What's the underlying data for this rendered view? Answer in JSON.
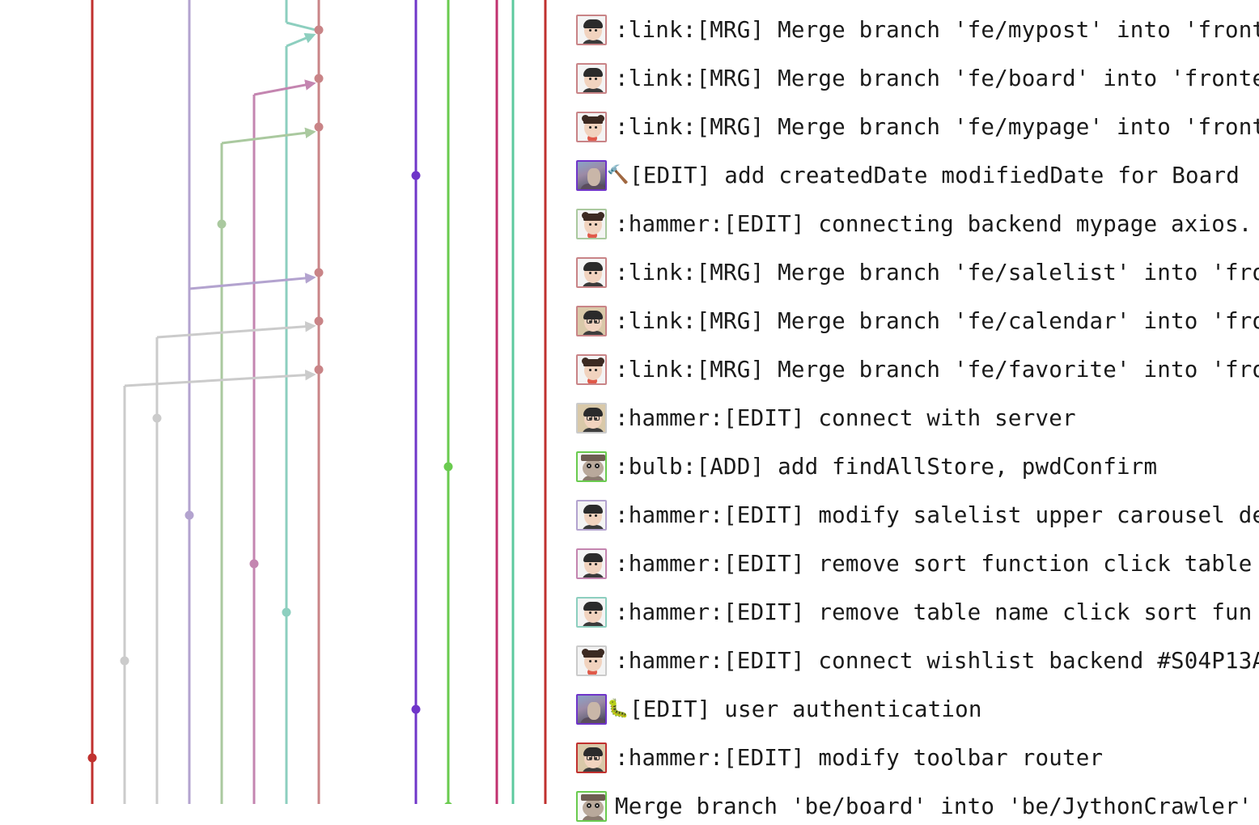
{
  "lanes": [
    {
      "id": "red-main",
      "color": "#c0312f"
    },
    {
      "id": "grey-a",
      "color": "#cbcbcb"
    },
    {
      "id": "grey-b",
      "color": "#cbcbcb"
    },
    {
      "id": "lavender",
      "color": "#b3a3cf"
    },
    {
      "id": "sage",
      "color": "#aac99f"
    },
    {
      "id": "pink",
      "color": "#c485b0"
    },
    {
      "id": "teal",
      "color": "#8dcfbf"
    },
    {
      "id": "rose",
      "color": "#c98487"
    },
    {
      "id": "purple",
      "color": "#6f35c9"
    },
    {
      "id": "green",
      "color": "#6acb4f"
    },
    {
      "id": "magenta",
      "color": "#c0316f"
    },
    {
      "id": "mint",
      "color": "#5cc99e"
    },
    {
      "id": "brick",
      "color": "#c0312f"
    }
  ],
  "commits": [
    {
      "avatar": "round-boy",
      "border": "#c98487",
      "icon": "",
      "message": ":link:[MRG] Merge branch 'fe/mypost' into 'front"
    },
    {
      "avatar": "round-boy",
      "border": "#c98487",
      "icon": "",
      "message": ":link:[MRG] Merge branch 'fe/board' into 'fronte"
    },
    {
      "avatar": "girl",
      "border": "#c98487",
      "icon": "",
      "message": ":link:[MRG] Merge branch 'fe/mypage' into 'front"
    },
    {
      "avatar": "photo",
      "border": "#6f35c9",
      "icon": "🔨",
      "message": "[EDIT] add createdDate modifiedDate for Board"
    },
    {
      "avatar": "girl",
      "border": "#aac99f",
      "icon": "",
      "message": ":hammer:[EDIT] connecting backend mypage axios."
    },
    {
      "avatar": "round-boy",
      "border": "#c98487",
      "icon": "",
      "message": ":link:[MRG] Merge branch 'fe/salelist' into 'fro"
    },
    {
      "avatar": "glasses",
      "border": "#c98487",
      "icon": "",
      "message": ":link:[MRG] Merge branch 'fe/calendar' into 'fro"
    },
    {
      "avatar": "girl",
      "border": "#c98487",
      "icon": "",
      "message": ":link:[MRG] Merge branch 'fe/favorite' into 'fro"
    },
    {
      "avatar": "glasses",
      "border": "#cbcbcb",
      "icon": "",
      "message": ":hammer:[EDIT] connect with server"
    },
    {
      "avatar": "owl",
      "border": "#6acb4f",
      "icon": "",
      "message": ":bulb:[ADD] add findAllStore, pwdConfirm"
    },
    {
      "avatar": "round-boy",
      "border": "#b3a3cf",
      "icon": "",
      "message": ":hammer:[EDIT] modify salelist upper carousel de"
    },
    {
      "avatar": "round-boy",
      "border": "#c485b0",
      "icon": "",
      "message": ":hammer:[EDIT] remove sort function click table"
    },
    {
      "avatar": "round-boy",
      "border": "#8dcfbf",
      "icon": "",
      "message": ":hammer:[EDIT] remove table name click sort fun"
    },
    {
      "avatar": "girl",
      "border": "#cbcbcb",
      "icon": "",
      "message": ":hammer:[EDIT] connect wishlist backend #S04P13A"
    },
    {
      "avatar": "photo",
      "border": "#6f35c9",
      "icon": "🐛",
      "message": "[EDIT] user authentication"
    },
    {
      "avatar": "glasses",
      "border": "#c0312f",
      "icon": "",
      "message": ":hammer:[EDIT] modify toolbar router"
    },
    {
      "avatar": "owl",
      "border": "#6acb4f",
      "icon": "",
      "message": "Merge branch 'be/board' into 'be/JythonCrawler'"
    }
  ]
}
